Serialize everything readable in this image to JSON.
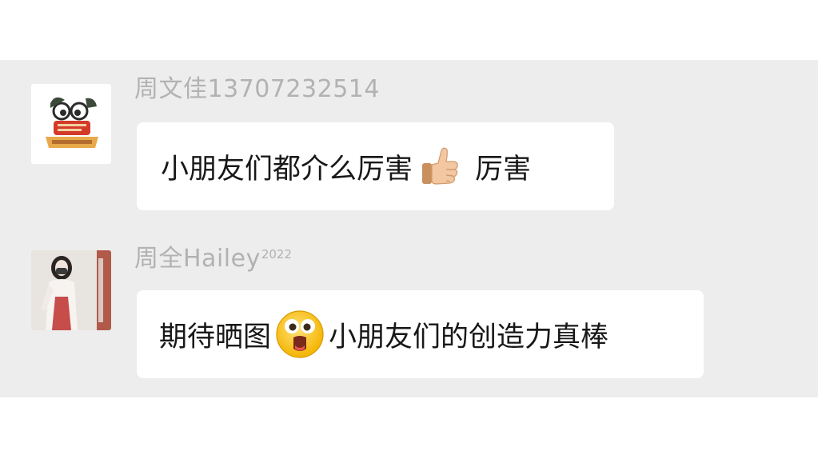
{
  "messages": [
    {
      "sender": "周文佳13707232514",
      "avatar_icon": "cartoon-brand-logo-icon",
      "text_before": "小朋友们都介么厉害",
      "emoji": "thumbs-up-icon",
      "text_after": "厉害"
    },
    {
      "sender": "周全Hailey",
      "sender_sup": "2022",
      "avatar_icon": "profile-photo-woman",
      "text_before": "期待晒图",
      "emoji": "surprised-face-icon",
      "text_after": "小朋友们的创造力真棒"
    }
  ],
  "colors": {
    "panel_background": "#ededed",
    "bubble_background": "#ffffff",
    "sender_name": "#b2b2b2",
    "message_text": "#181818"
  }
}
